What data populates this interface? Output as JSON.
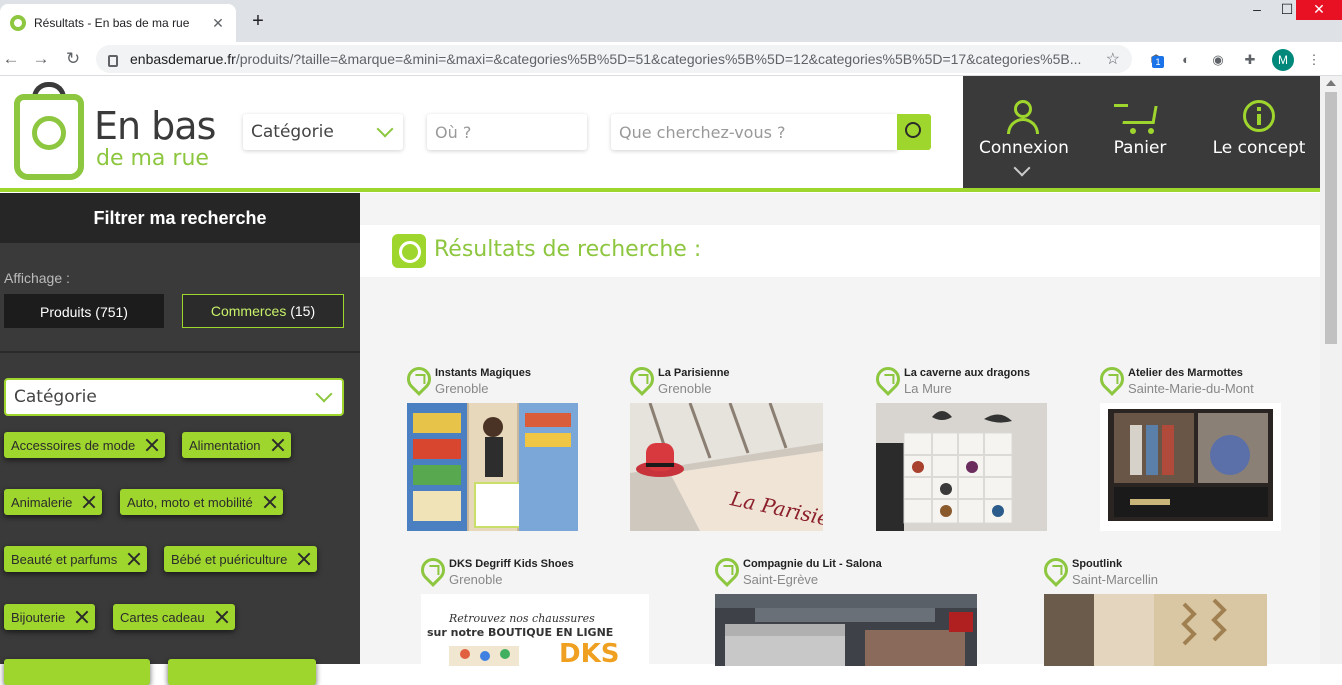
{
  "browser": {
    "tab_title": "Résultats - En bas de ma rue",
    "url_domain": "enbasdemarue.fr",
    "url_path": "/produits/?taille=&marque=&mini=&maxi=&categories%5B%5D=51&categories%5B%5D=12&categories%5B%5D=17&categories%5B...",
    "ext_badge": "1",
    "avatar_initial": "M"
  },
  "header": {
    "logo_line1": "En bas",
    "logo_line2": "de ma rue",
    "category_select": "Catégorie",
    "where_placeholder": "Où ?",
    "search_placeholder": "Que cherchez-vous ?",
    "login": "Connexion",
    "cart": "Panier",
    "concept": "Le concept"
  },
  "sidebar": {
    "title": "Filtrer ma recherche",
    "affichage_label": "Affichage :",
    "products_label": "Produits (751)",
    "shops_label": "Commerces",
    "shops_count": "(15)",
    "category_select": "Catégorie",
    "tags": [
      "Accessoires de mode",
      "Alimentation",
      "Animalerie",
      "Auto, moto et mobilité",
      "Beauté et parfums",
      "Bébé et puériculture",
      "Bijouterie",
      "Cartes cadeau"
    ]
  },
  "main": {
    "results_title": "Résultats de recherche :",
    "cards": [
      {
        "name": "Instants Magiques",
        "city": "Grenoble"
      },
      {
        "name": "La Parisienne",
        "city": "Grenoble"
      },
      {
        "name": "La caverne aux dragons",
        "city": "La Mure"
      },
      {
        "name": "Atelier des Marmottes",
        "city": "Sainte-Marie-du-Mont"
      },
      {
        "name": "DKS Degriff Kids Shoes",
        "city": "Grenoble"
      },
      {
        "name": "Compagnie du Lit - Salona",
        "city": "Saint-Egrève"
      },
      {
        "name": "Spoutlink",
        "city": "Saint-Marcellin"
      }
    ],
    "dks_banner_line1": "Retrouvez nos chaussures",
    "dks_banner_line2": "sur notre BOUTIQUE EN LIGNE",
    "dks_logo": "DKS",
    "parisienne_sign": "La Parisienne"
  },
  "colors": {
    "accent": "#9fd62d",
    "dark": "#3a3a3a"
  }
}
